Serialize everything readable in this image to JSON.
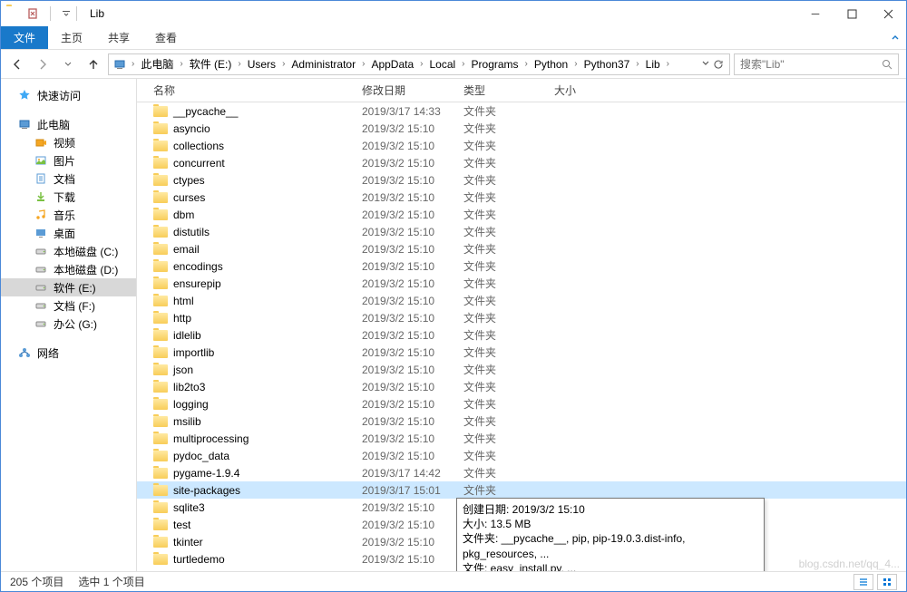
{
  "title": "Lib",
  "menu": {
    "file": "文件",
    "home": "主页",
    "share": "共享",
    "view": "查看"
  },
  "breadcrumbs": [
    "此电脑",
    "软件 (E:)",
    "Users",
    "Administrator",
    "AppData",
    "Local",
    "Programs",
    "Python",
    "Python37",
    "Lib"
  ],
  "search_placeholder": "搜索\"Lib\"",
  "columns": {
    "name": "名称",
    "date": "修改日期",
    "type": "类型",
    "size": "大小"
  },
  "nav": {
    "quickaccess": "快速访问",
    "thispc": "此电脑",
    "items": [
      {
        "label": "视频"
      },
      {
        "label": "图片"
      },
      {
        "label": "文档"
      },
      {
        "label": "下载"
      },
      {
        "label": "音乐"
      },
      {
        "label": "桌面"
      },
      {
        "label": "本地磁盘 (C:)"
      },
      {
        "label": "本地磁盘 (D:)"
      },
      {
        "label": "软件 (E:)",
        "selected": true
      },
      {
        "label": "文档 (F:)"
      },
      {
        "label": "办公 (G:)"
      }
    ],
    "network": "网络"
  },
  "folder_type": "文件夹",
  "files": [
    {
      "name": "__pycache__",
      "date": "2019/3/17 14:33"
    },
    {
      "name": "asyncio",
      "date": "2019/3/2 15:10"
    },
    {
      "name": "collections",
      "date": "2019/3/2 15:10"
    },
    {
      "name": "concurrent",
      "date": "2019/3/2 15:10"
    },
    {
      "name": "ctypes",
      "date": "2019/3/2 15:10"
    },
    {
      "name": "curses",
      "date": "2019/3/2 15:10"
    },
    {
      "name": "dbm",
      "date": "2019/3/2 15:10"
    },
    {
      "name": "distutils",
      "date": "2019/3/2 15:10"
    },
    {
      "name": "email",
      "date": "2019/3/2 15:10"
    },
    {
      "name": "encodings",
      "date": "2019/3/2 15:10"
    },
    {
      "name": "ensurepip",
      "date": "2019/3/2 15:10"
    },
    {
      "name": "html",
      "date": "2019/3/2 15:10"
    },
    {
      "name": "http",
      "date": "2019/3/2 15:10"
    },
    {
      "name": "idlelib",
      "date": "2019/3/2 15:10"
    },
    {
      "name": "importlib",
      "date": "2019/3/2 15:10"
    },
    {
      "name": "json",
      "date": "2019/3/2 15:10"
    },
    {
      "name": "lib2to3",
      "date": "2019/3/2 15:10"
    },
    {
      "name": "logging",
      "date": "2019/3/2 15:10"
    },
    {
      "name": "msilib",
      "date": "2019/3/2 15:10"
    },
    {
      "name": "multiprocessing",
      "date": "2019/3/2 15:10"
    },
    {
      "name": "pydoc_data",
      "date": "2019/3/2 15:10"
    },
    {
      "name": "pygame-1.9.4",
      "date": "2019/3/17 14:42"
    },
    {
      "name": "site-packages",
      "date": "2019/3/17 15:01",
      "selected": true
    },
    {
      "name": "sqlite3",
      "date": "2019/3/2 15:10"
    },
    {
      "name": "test",
      "date": "2019/3/2 15:10"
    },
    {
      "name": "tkinter",
      "date": "2019/3/2 15:10"
    },
    {
      "name": "turtledemo",
      "date": "2019/3/2 15:10"
    }
  ],
  "tooltip": {
    "l1": "创建日期: 2019/3/2 15:10",
    "l2": "大小: 13.5 MB",
    "l3": "文件夹: __pycache__, pip, pip-19.0.3.dist-info, pkg_resources, ...",
    "l4": "文件: easy_install.py, ..."
  },
  "status": {
    "count": "205 个项目",
    "selected": "选中 1 个项目"
  },
  "watermark": "blog.csdn.net/qq_4..."
}
